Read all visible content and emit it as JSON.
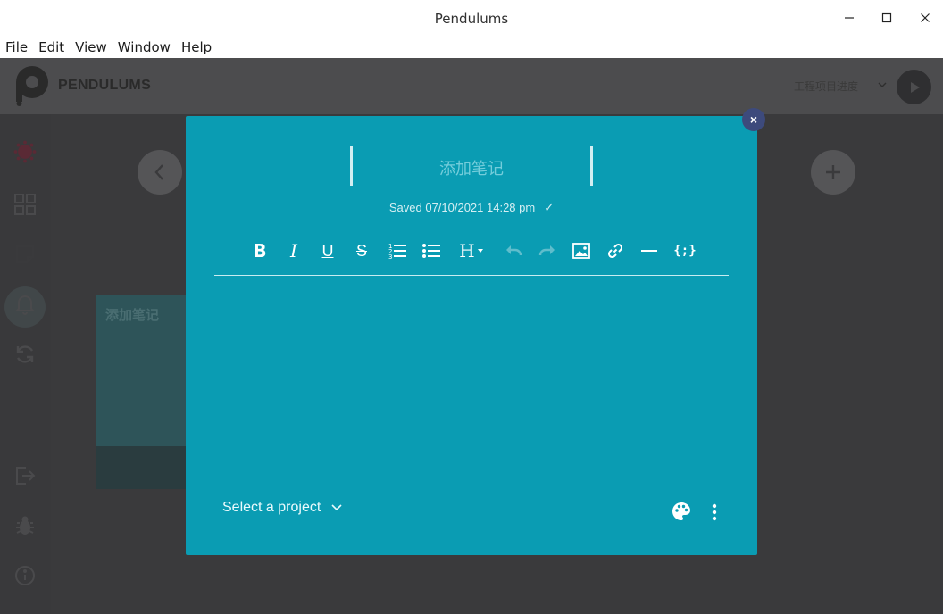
{
  "window": {
    "title": "Pendulums"
  },
  "menu": {
    "items": [
      "File",
      "Edit",
      "View",
      "Window",
      "Help"
    ]
  },
  "header": {
    "brand": "PENDULUMS",
    "project": "工程项目进度"
  },
  "background_card": {
    "title": "添加笔记"
  },
  "editor": {
    "title_value": "添加笔记",
    "saved_text": "Saved 07/10/2021 14:28 pm",
    "saved_check": "✓",
    "close_label": "×",
    "toolbar": {
      "bold": "B",
      "italic": "I",
      "underline": "U",
      "strikethrough": "S",
      "heading": "H",
      "code": "{;}"
    },
    "project_select_label": "Select a project"
  },
  "colors": {
    "modal_bg": "#0a9cb3",
    "app_bg": "#3a3a3c",
    "header_bg": "#4c4c4e",
    "close_bg": "#3d4a7c"
  }
}
